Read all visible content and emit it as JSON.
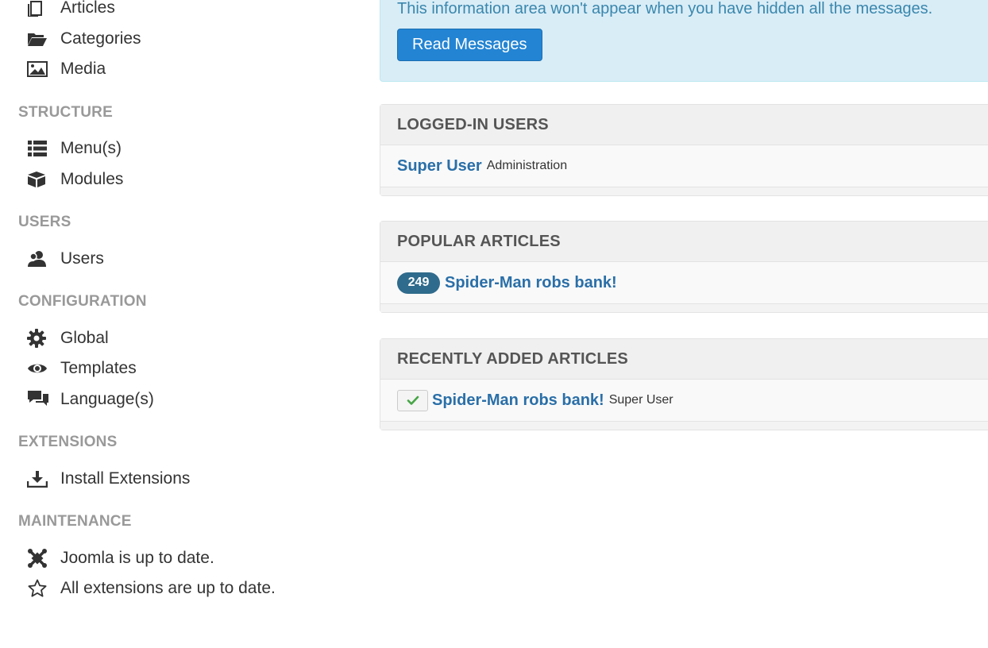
{
  "sidebar": {
    "content_items": [
      {
        "label": "Articles",
        "icon": "articles-icon"
      },
      {
        "label": "Categories",
        "icon": "folder-open-icon"
      },
      {
        "label": "Media",
        "icon": "image-icon"
      }
    ],
    "sections": {
      "structure": "STRUCTURE",
      "users": "USERS",
      "configuration": "CONFIGURATION",
      "extensions": "EXTENSIONS",
      "maintenance": "MAINTENANCE"
    },
    "structure_items": [
      {
        "label": "Menu(s)",
        "icon": "list-icon"
      },
      {
        "label": "Modules",
        "icon": "cube-icon"
      }
    ],
    "users_items": [
      {
        "label": "Users",
        "icon": "users-icon"
      }
    ],
    "configuration_items": [
      {
        "label": "Global",
        "icon": "gear-icon"
      },
      {
        "label": "Templates",
        "icon": "eye-icon"
      },
      {
        "label": "Language(s)",
        "icon": "comments-icon"
      }
    ],
    "extensions_items": [
      {
        "label": "Install Extensions",
        "icon": "download-icon"
      }
    ],
    "maintenance_items": [
      {
        "label": "Joomla is up to date.",
        "icon": "joomla-icon"
      },
      {
        "label": "All extensions are up to date.",
        "icon": "star-outline-icon"
      }
    ]
  },
  "alert": {
    "text": "This information area won't appear when you have hidden all the messages.",
    "button_label": "Read Messages"
  },
  "logged_in_users": {
    "title": "LOGGED-IN USERS",
    "rows": [
      {
        "name": "Super User",
        "location": "Administration"
      }
    ]
  },
  "popular_articles": {
    "title": "POPULAR ARTICLES",
    "rows": [
      {
        "hits": "249",
        "title": "Spider-Man robs bank!"
      }
    ]
  },
  "recent_articles": {
    "title": "RECENTLY ADDED ARTICLES",
    "rows": [
      {
        "title": "Spider-Man robs bank!",
        "author": "Super User",
        "status_icon": "check-icon"
      }
    ]
  },
  "colors": {
    "alert_bg": "#d9edf7",
    "alert_text": "#3a87ad",
    "primary_button": "#2384d3",
    "link": "#2a6fa8",
    "badge": "#2f6b8c",
    "section_title": "#999999",
    "check_green": "#46a546"
  }
}
